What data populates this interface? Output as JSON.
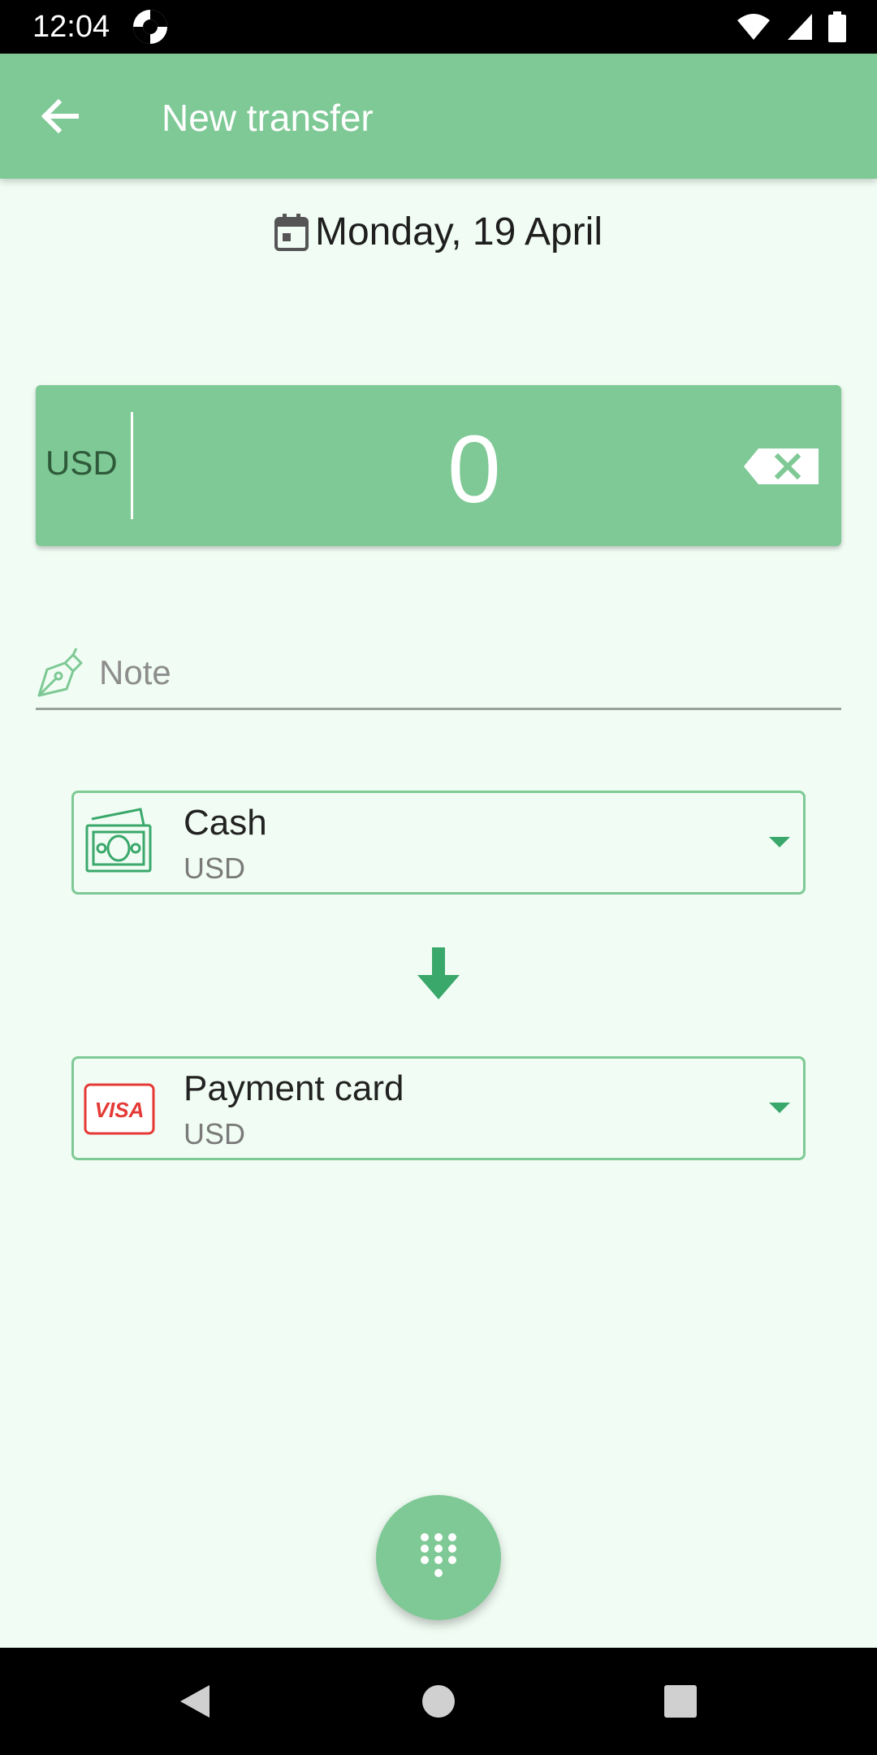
{
  "status_bar": {
    "time": "12:04",
    "icons": [
      "app-notification-icon",
      "wifi-icon",
      "signal-icon",
      "battery-icon"
    ]
  },
  "app_bar": {
    "title": "New transfer",
    "back_icon": "arrow-back-icon"
  },
  "date": {
    "label": "Monday, 19 April",
    "icon": "calendar-icon"
  },
  "amount": {
    "currency": "USD",
    "value": "0",
    "backspace_icon": "backspace-icon"
  },
  "note": {
    "placeholder": "Note",
    "icon": "pen-icon"
  },
  "from_account": {
    "name": "Cash",
    "currency": "USD",
    "icon": "cash-icon"
  },
  "to_account": {
    "name": "Payment card",
    "currency": "USD",
    "icon": "visa-card-icon",
    "icon_text": "VISA"
  },
  "fab": {
    "icon": "dialpad-icon"
  },
  "colors": {
    "primary": "#7ec995",
    "background": "#f1fdf4",
    "accent_dark": "#3aa86b",
    "visa_red": "#e53935"
  }
}
